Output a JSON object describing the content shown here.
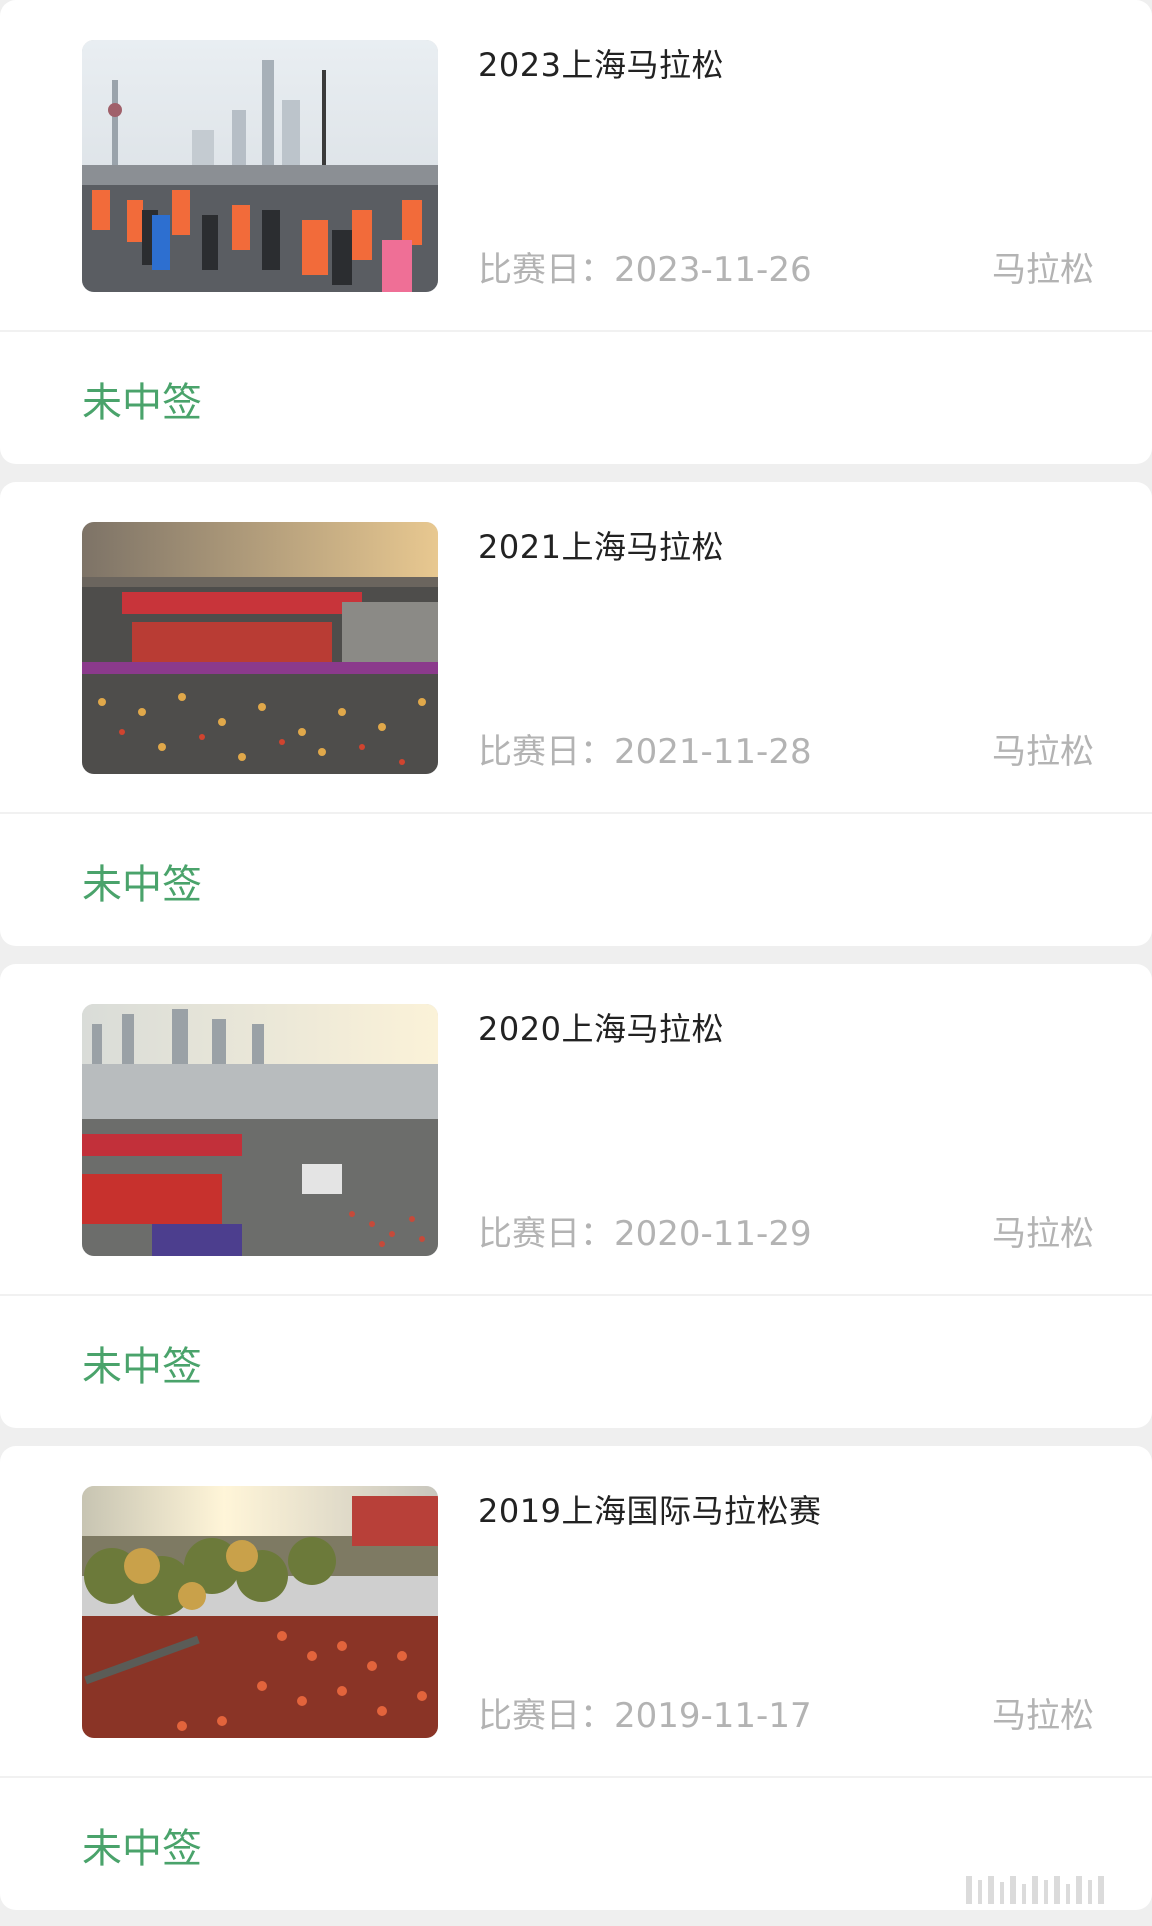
{
  "races": [
    {
      "title": "2023上海马拉松",
      "date_label": "比赛日：2023-11-26",
      "type": "马拉松",
      "status": "未中签",
      "image": "marathon-runners-city-skyline-photo"
    },
    {
      "title": "2021上海马拉松",
      "date_label": "比赛日：2021-11-28",
      "type": "马拉松",
      "status": "未中签",
      "image": "marathon-start-line-riverside-photo"
    },
    {
      "title": "2020上海马拉松",
      "date_label": "比赛日：2020-11-29",
      "type": "马拉松",
      "status": "未中签",
      "image": "marathon-bund-aerial-photo"
    },
    {
      "title": "2019上海国际马拉松赛",
      "date_label": "比赛日：2019-11-17",
      "type": "马拉松",
      "status": "未中签",
      "image": "marathon-crowd-sunrise-photo"
    }
  ],
  "colors": {
    "status": "#4aa36b",
    "meta": "#b3b3b3",
    "title": "#222222",
    "background": "#efefef"
  }
}
